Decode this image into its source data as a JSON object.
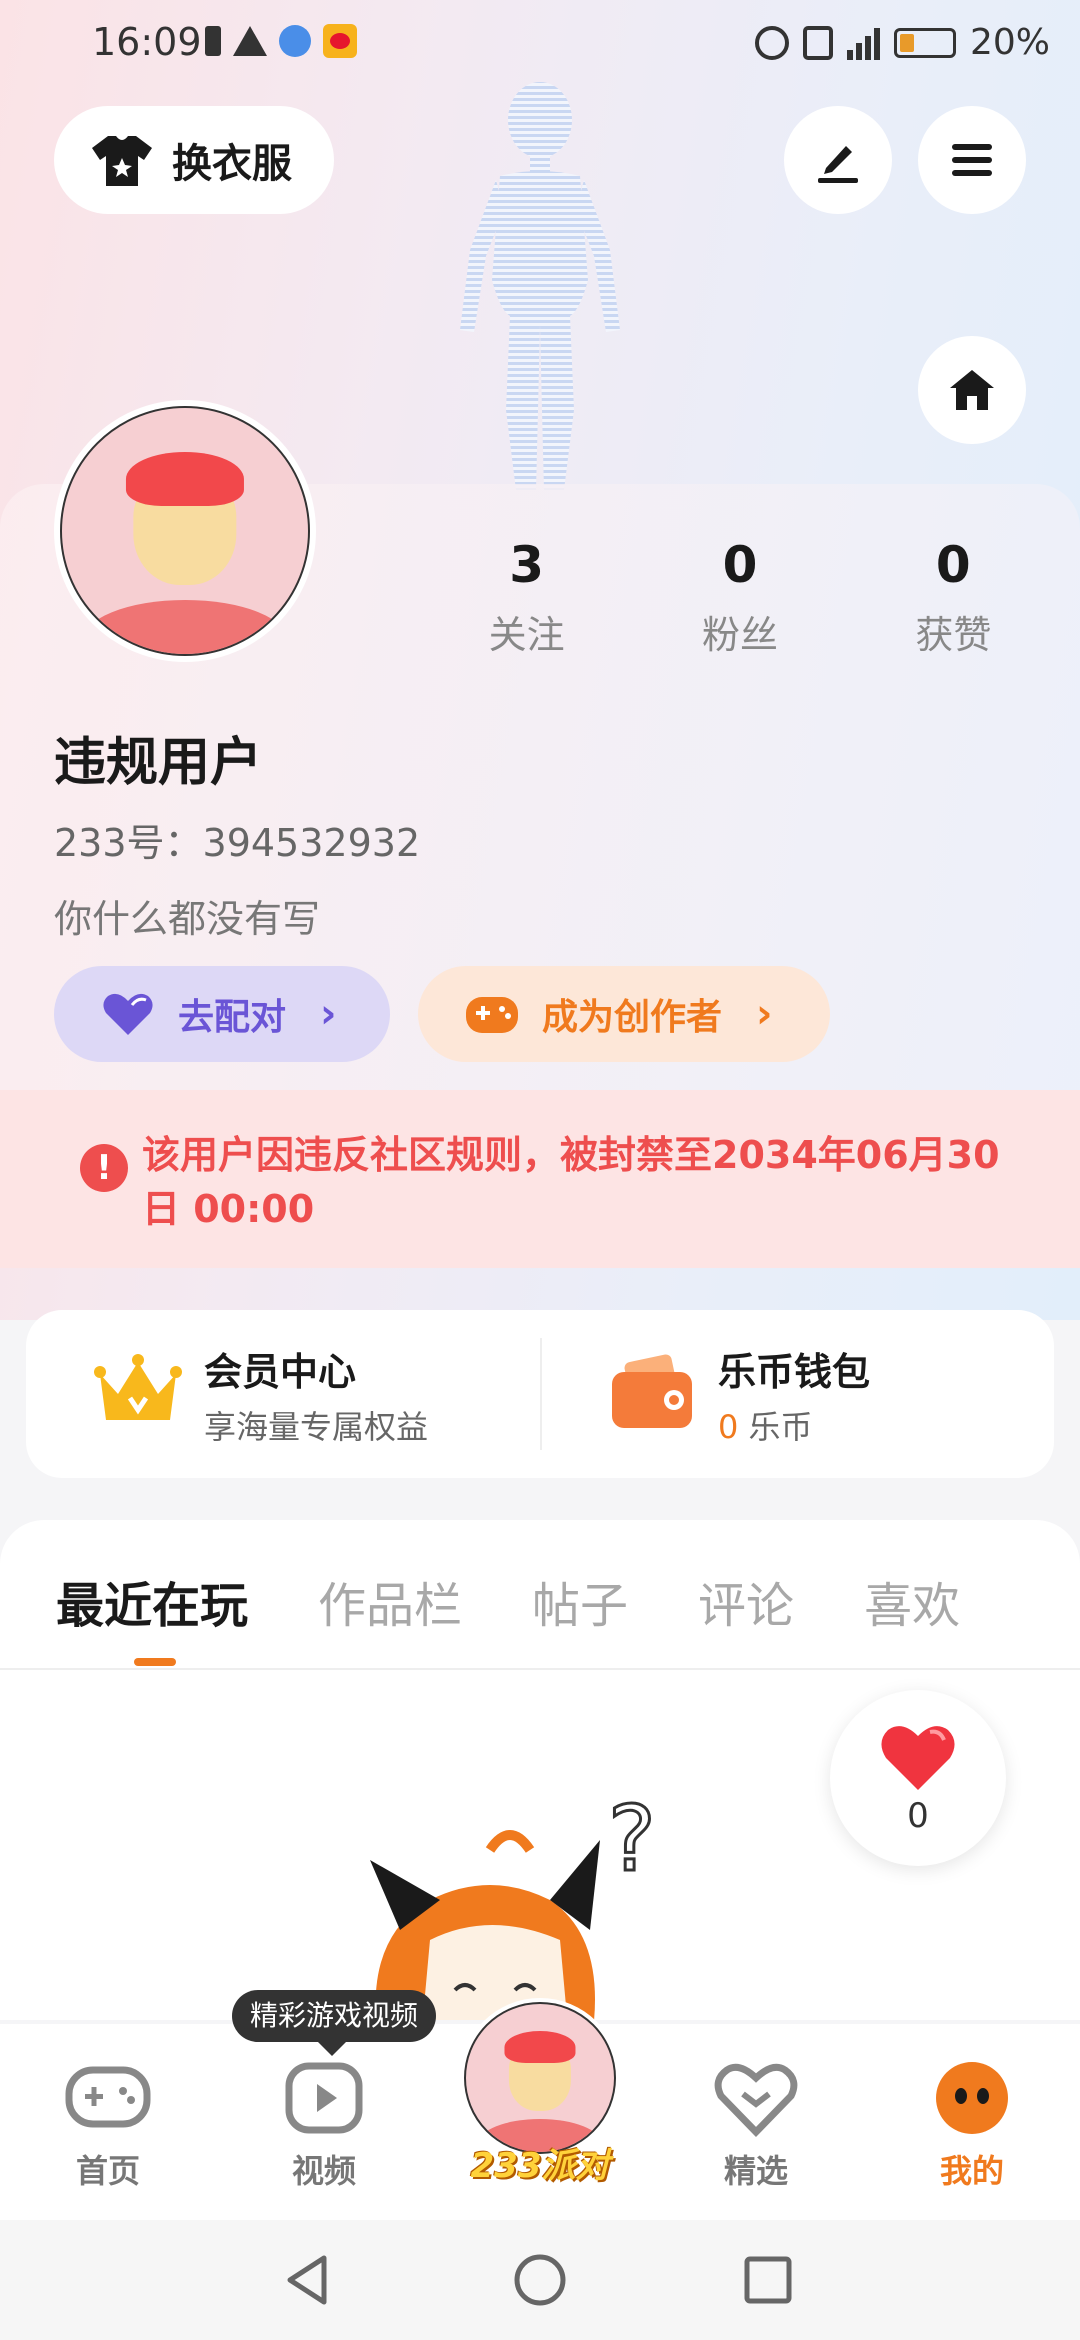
{
  "status_bar": {
    "time": "16:09",
    "battery_pct": "20%",
    "icons": [
      "battery-small-icon",
      "warning-icon",
      "browser-icon",
      "weibo-icon",
      "alarm-icon",
      "vibrate-icon",
      "signal-icon",
      "battery-icon"
    ]
  },
  "header": {
    "outfit_label": "换衣服",
    "edit_icon": "edit-icon",
    "menu_icon": "menu-icon",
    "home_icon": "home-icon"
  },
  "profile": {
    "stats": [
      {
        "value": "3",
        "label": "关注"
      },
      {
        "value": "0",
        "label": "粉丝"
      },
      {
        "value": "0",
        "label": "获赞"
      }
    ],
    "name": "违规用户",
    "id_line": "233号：394532932",
    "bio": "你什么都没有写",
    "match_button": "去配对",
    "creator_button": "成为创作者"
  },
  "ban_notice": {
    "text": "该用户因违反社区规则，被封禁至2034年06月30日 00:00"
  },
  "member": {
    "title": "会员中心",
    "subtitle": "享海量专属权益"
  },
  "wallet": {
    "title": "乐币钱包",
    "coin_amount": "0",
    "coin_unit": "乐币"
  },
  "tabs": [
    "最近在玩",
    "作品栏",
    "帖子",
    "评论",
    "喜欢"
  ],
  "like_float": {
    "count": "0"
  },
  "bottom_nav": {
    "tooltip": "精彩游戏视频",
    "items": [
      {
        "label": "首页"
      },
      {
        "label": "视频"
      },
      {
        "label": "233派对"
      },
      {
        "label": "精选"
      },
      {
        "label": "我的"
      }
    ]
  },
  "colors": {
    "accent": "#f07a1e",
    "ban_red": "#ee4e4e",
    "match_purple": "#6a55d6"
  }
}
